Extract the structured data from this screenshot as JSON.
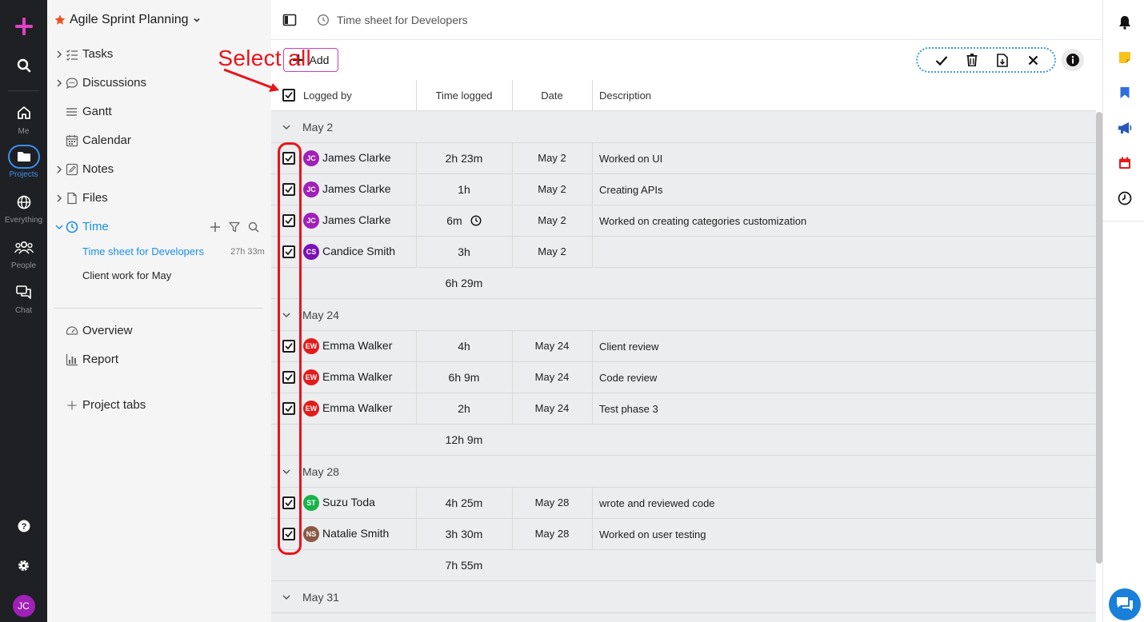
{
  "rail": {
    "items": [
      {
        "label": "Me"
      },
      {
        "label": "Projects"
      },
      {
        "label": "Everything"
      },
      {
        "label": "People"
      },
      {
        "label": "Chat"
      }
    ],
    "user_initials": "JC"
  },
  "sidebar": {
    "project_title": "Agile Sprint Planning",
    "nav": [
      {
        "label": "Tasks"
      },
      {
        "label": "Discussions"
      },
      {
        "label": "Gantt"
      },
      {
        "label": "Calendar"
      },
      {
        "label": "Notes"
      },
      {
        "label": "Files"
      },
      {
        "label": "Time"
      }
    ],
    "sheets": [
      {
        "label": "Time sheet for Developers",
        "meta": "27h 33m"
      },
      {
        "label": "Client work for May",
        "meta": ""
      }
    ],
    "extra": [
      {
        "label": "Overview"
      },
      {
        "label": "Report"
      }
    ],
    "project_tabs": "Project tabs"
  },
  "header": {
    "title": "Time sheet for Developers"
  },
  "toolbar": {
    "add_label": "Add"
  },
  "annotation": {
    "text": "Select all"
  },
  "table": {
    "columns": [
      "Logged by",
      "Time logged",
      "Date",
      "Description"
    ],
    "groups": [
      {
        "label": "May 2",
        "total": "6h 29m",
        "rows": [
          {
            "initials": "JC",
            "color": "#a020b8",
            "name": "James Clarke",
            "time": "2h 23m",
            "date": "May 2",
            "desc": "Worked on UI",
            "timer": false
          },
          {
            "initials": "JC",
            "color": "#a020b8",
            "name": "James Clarke",
            "time": "1h",
            "date": "May 2",
            "desc": "Creating APIs",
            "timer": false
          },
          {
            "initials": "JC",
            "color": "#a020b8",
            "name": "James Clarke",
            "time": "6m",
            "date": "May 2",
            "desc": "Worked on creating categories customization",
            "timer": true
          },
          {
            "initials": "CS",
            "color": "#7a12b5",
            "name": "Candice Smith",
            "time": "3h",
            "date": "May 2",
            "desc": "",
            "timer": false
          }
        ]
      },
      {
        "label": "May 24",
        "total": "12h 9m",
        "rows": [
          {
            "initials": "EW",
            "color": "#e41b1b",
            "name": "Emma Walker",
            "time": "4h",
            "date": "May 24",
            "desc": "Client review",
            "timer": false
          },
          {
            "initials": "EW",
            "color": "#e41b1b",
            "name": "Emma Walker",
            "time": "6h 9m",
            "date": "May 24",
            "desc": "Code review",
            "timer": false
          },
          {
            "initials": "EW",
            "color": "#e41b1b",
            "name": "Emma Walker",
            "time": "2h",
            "date": "May 24",
            "desc": "Test phase 3",
            "timer": false
          }
        ]
      },
      {
        "label": "May 28",
        "total": "7h 55m",
        "rows": [
          {
            "initials": "ST",
            "color": "#16b34a",
            "name": "Suzu Toda",
            "time": "4h 25m",
            "date": "May 28",
            "desc": "wrote and reviewed code",
            "timer": false
          },
          {
            "initials": "NS",
            "color": "#8a5a44",
            "name": "Natalie Smith",
            "time": "3h 30m",
            "date": "May 28",
            "desc": "Worked on user testing",
            "timer": false
          }
        ]
      },
      {
        "label": "May 31",
        "total": "",
        "rows": []
      }
    ]
  }
}
